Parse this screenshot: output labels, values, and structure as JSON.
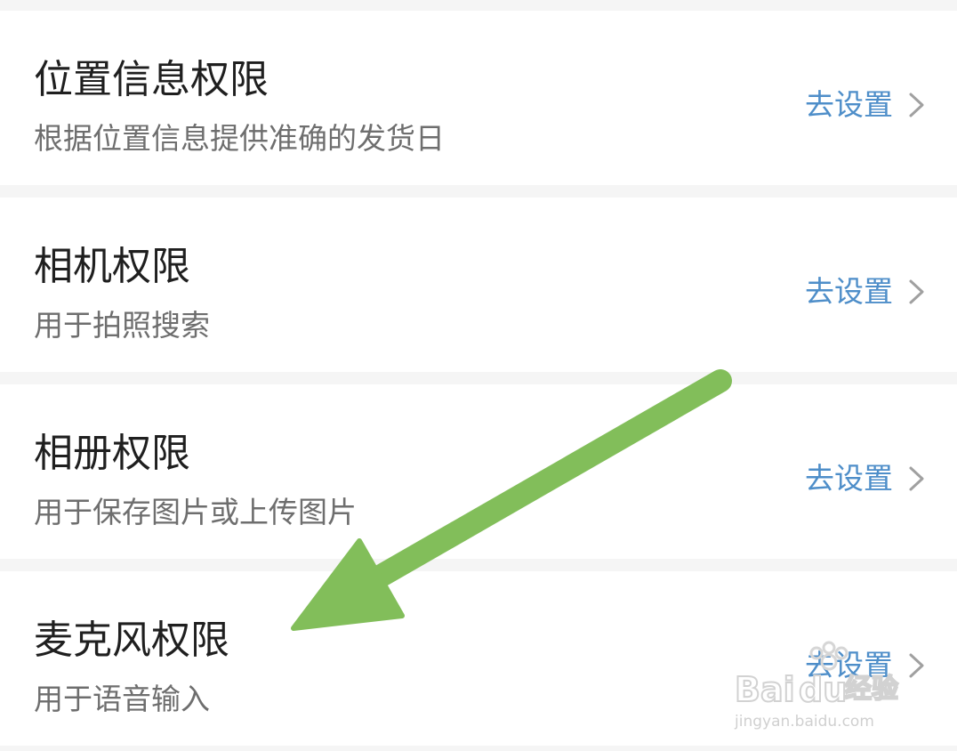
{
  "permissions": [
    {
      "title": "位置信息权限",
      "description": "根据位置信息提供准确的发货日",
      "action_label": "去设置",
      "action_icon": "chevron-right-icon"
    },
    {
      "title": "相机权限",
      "description": "用于拍照搜索",
      "action_label": "去设置",
      "action_icon": "chevron-right-icon"
    },
    {
      "title": "相册权限",
      "description": "用于保存图片或上传图片",
      "action_label": "去设置",
      "action_icon": "chevron-right-icon"
    },
    {
      "title": "麦克风权限",
      "description": "用于语音输入",
      "action_label": "去设置",
      "action_icon": "chevron-right-icon"
    }
  ],
  "annotation": {
    "icon": "arrow-icon",
    "color": "#82be5a"
  },
  "watermark": {
    "brand": "Baidu经验",
    "url": "jingyan.baidu.com"
  },
  "colors": {
    "page_background": "#f5f5f5",
    "row_background": "#ffffff",
    "title": "#1f1f1f",
    "description": "#6e6e6e",
    "link": "#4e8ec9",
    "chevron": "#a0a0a0"
  }
}
